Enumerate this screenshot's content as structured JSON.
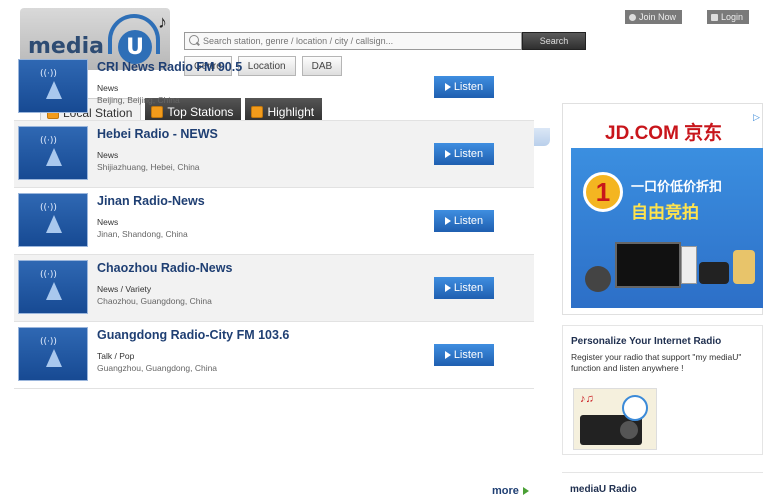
{
  "header": {
    "logo_text": "media",
    "logo_letter": "U",
    "search": {
      "placeholder": "Search station, genre / location / city / callsign...",
      "button_label": "Search"
    },
    "filters": [
      "Genre",
      "Location",
      "DAB"
    ],
    "account": {
      "join_label": "Join Now",
      "login_label": "Login"
    }
  },
  "tabs": [
    {
      "label": "Local Station",
      "active": true
    },
    {
      "label": "Top Stations",
      "active": false
    },
    {
      "label": "Highlight",
      "active": false
    }
  ],
  "stations": [
    {
      "name": "CRI News Radio FM 90.5",
      "genre": "News",
      "location": "Beijing, Beijing, China"
    },
    {
      "name": "Hebei Radio - NEWS",
      "genre": "News",
      "location": "Shijiazhuang, Hebei, China"
    },
    {
      "name": "Jinan Radio-News",
      "genre": "News",
      "location": "Jinan, Shandong, China"
    },
    {
      "name": "Chaozhou Radio-News",
      "genre": "News / Variety",
      "location": "Chaozhou, Guangdong, China"
    },
    {
      "name": "Guangdong Radio-City FM 103.6",
      "genre": "Talk / Pop",
      "location": "Guangzhou, Guangdong, China"
    }
  ],
  "listen_label": "Listen",
  "more_label": "more",
  "ad": {
    "brand": "JD.COM 京东",
    "digit": "1",
    "line1": "一口价低价折扣",
    "line2": "自由竞拍"
  },
  "promo": {
    "title": "Personalize Your Internet Radio",
    "text": "Register your radio that support \"my mediaU\" function and listen anywhere !"
  },
  "mediau_radio_title": "mediaU Radio",
  "colors": {
    "link": "#1f3f73",
    "listen_button": "#2a72c8",
    "tab_icon": "#f29b1b"
  }
}
